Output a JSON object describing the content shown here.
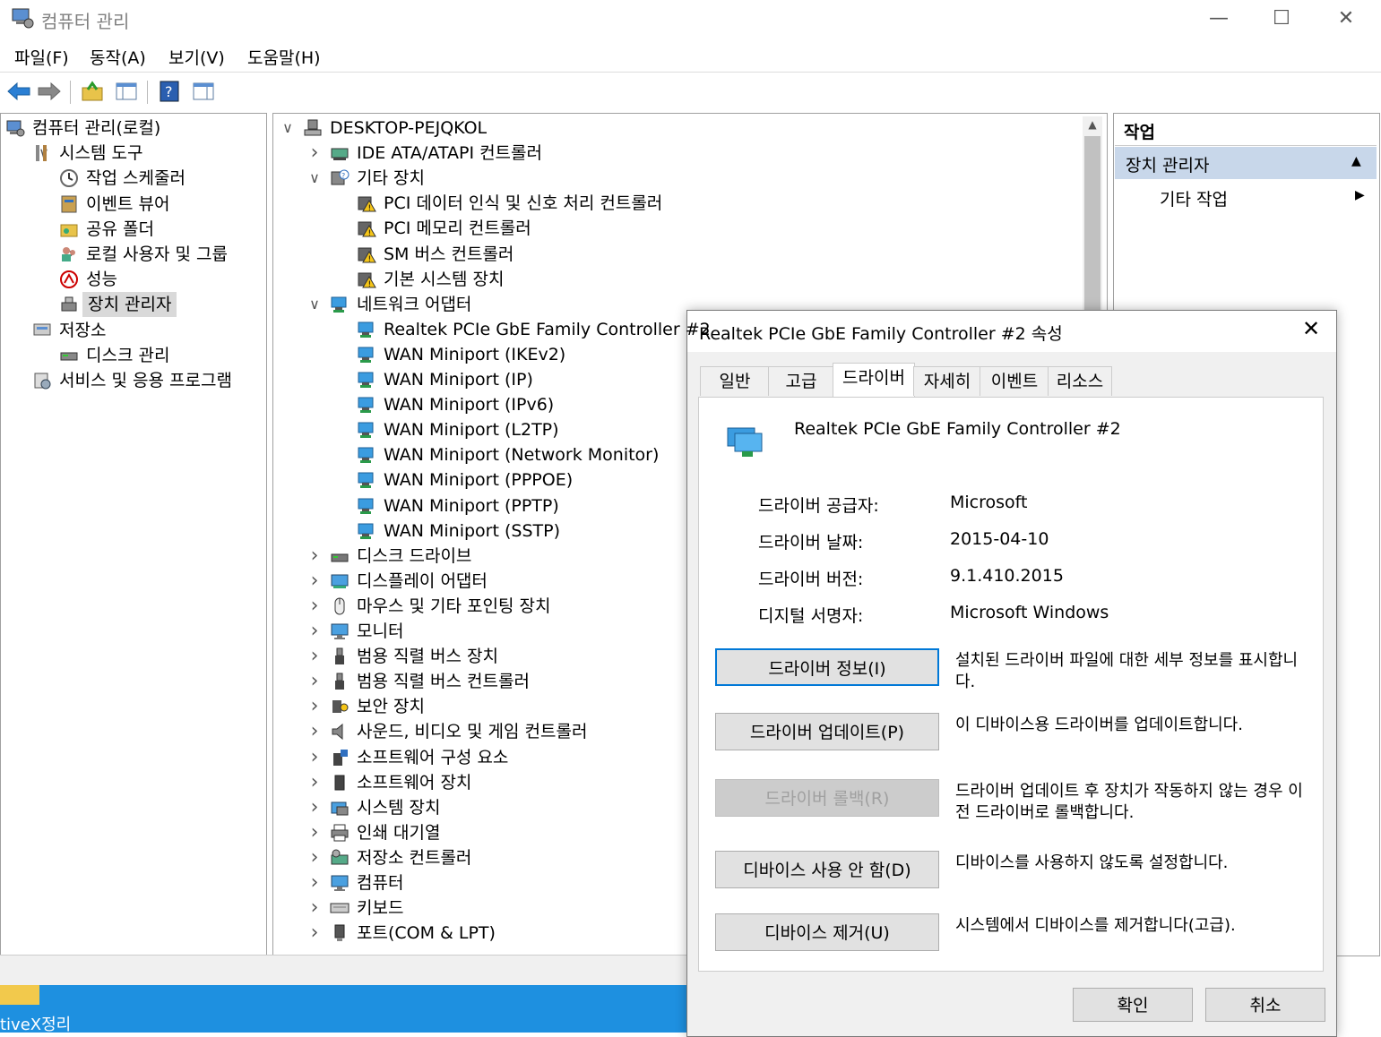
{
  "window": {
    "title": "컴퓨터 관리"
  },
  "menu": [
    "파일(F)",
    "동작(A)",
    "보기(V)",
    "도움말(H)"
  ],
  "left_tree": [
    {
      "label": "컴퓨터 관리(로컬)",
      "indent": 0,
      "chev": "",
      "icon": "computer-management-icon"
    },
    {
      "label": "시스템 도구",
      "indent": 1,
      "chev": "v",
      "icon": "tools-icon"
    },
    {
      "label": "작업 스케줄러",
      "indent": 2,
      "chev": ">",
      "icon": "clock-icon"
    },
    {
      "label": "이벤트 뷰어",
      "indent": 2,
      "chev": ">",
      "icon": "event-viewer-icon"
    },
    {
      "label": "공유 폴더",
      "indent": 2,
      "chev": ">",
      "icon": "shared-folder-icon"
    },
    {
      "label": "로컬 사용자 및 그룹",
      "indent": 2,
      "chev": ">",
      "icon": "users-icon"
    },
    {
      "label": "성능",
      "indent": 2,
      "chev": ">",
      "icon": "performance-icon"
    },
    {
      "label": "장치 관리자",
      "indent": 2,
      "chev": "",
      "icon": "device-manager-icon",
      "selected": true
    },
    {
      "label": "저장소",
      "indent": 1,
      "chev": "v",
      "icon": "storage-icon"
    },
    {
      "label": "디스크 관리",
      "indent": 2,
      "chev": "",
      "icon": "disk-management-icon"
    },
    {
      "label": "서비스 및 응용 프로그램",
      "indent": 1,
      "chev": ">",
      "icon": "services-icon"
    }
  ],
  "device_tree": [
    {
      "label": "DESKTOP-PEJQKOL",
      "indent": 0,
      "chev": "v",
      "icon": "computer-icon"
    },
    {
      "label": "IDE ATA/ATAPI 컨트롤러",
      "indent": 1,
      "chev": ">",
      "icon": "ide-controller-icon"
    },
    {
      "label": "기타 장치",
      "indent": 1,
      "chev": "v",
      "icon": "unknown-device-icon"
    },
    {
      "label": "PCI 데이터 인식 및 신호 처리 컨트롤러",
      "indent": 2,
      "chev": "",
      "icon": "warning-device-icon"
    },
    {
      "label": "PCI 메모리 컨트롤러",
      "indent": 2,
      "chev": "",
      "icon": "warning-device-icon"
    },
    {
      "label": "SM 버스 컨트롤러",
      "indent": 2,
      "chev": "",
      "icon": "warning-device-icon"
    },
    {
      "label": "기본 시스템 장치",
      "indent": 2,
      "chev": "",
      "icon": "warning-device-icon"
    },
    {
      "label": "네트워크 어댑터",
      "indent": 1,
      "chev": "v",
      "icon": "network-adapter-icon"
    },
    {
      "label": "Realtek PCIe GbE Family Controller #2",
      "indent": 2,
      "chev": "",
      "icon": "network-adapter-icon"
    },
    {
      "label": "WAN Miniport (IKEv2)",
      "indent": 2,
      "chev": "",
      "icon": "network-adapter-icon"
    },
    {
      "label": "WAN Miniport (IP)",
      "indent": 2,
      "chev": "",
      "icon": "network-adapter-icon"
    },
    {
      "label": "WAN Miniport (IPv6)",
      "indent": 2,
      "chev": "",
      "icon": "network-adapter-icon"
    },
    {
      "label": "WAN Miniport (L2TP)",
      "indent": 2,
      "chev": "",
      "icon": "network-adapter-icon"
    },
    {
      "label": "WAN Miniport (Network Monitor)",
      "indent": 2,
      "chev": "",
      "icon": "network-adapter-icon"
    },
    {
      "label": "WAN Miniport (PPPOE)",
      "indent": 2,
      "chev": "",
      "icon": "network-adapter-icon"
    },
    {
      "label": "WAN Miniport (PPTP)",
      "indent": 2,
      "chev": "",
      "icon": "network-adapter-icon"
    },
    {
      "label": "WAN Miniport (SSTP)",
      "indent": 2,
      "chev": "",
      "icon": "network-adapter-icon"
    },
    {
      "label": "디스크 드라이브",
      "indent": 1,
      "chev": ">",
      "icon": "disk-drive-icon"
    },
    {
      "label": "디스플레이 어댑터",
      "indent": 1,
      "chev": ">",
      "icon": "display-adapter-icon"
    },
    {
      "label": "마우스 및 기타 포인팅 장치",
      "indent": 1,
      "chev": ">",
      "icon": "mouse-icon"
    },
    {
      "label": "모니터",
      "indent": 1,
      "chev": ">",
      "icon": "monitor-icon"
    },
    {
      "label": "범용 직렬 버스 장치",
      "indent": 1,
      "chev": ">",
      "icon": "usb-icon"
    },
    {
      "label": "범용 직렬 버스 컨트롤러",
      "indent": 1,
      "chev": ">",
      "icon": "usb-icon"
    },
    {
      "label": "보안 장치",
      "indent": 1,
      "chev": ">",
      "icon": "security-device-icon"
    },
    {
      "label": "사운드, 비디오 및 게임 컨트롤러",
      "indent": 1,
      "chev": ">",
      "icon": "speaker-icon"
    },
    {
      "label": "소프트웨어 구성 요소",
      "indent": 1,
      "chev": ">",
      "icon": "software-component-icon"
    },
    {
      "label": "소프트웨어 장치",
      "indent": 1,
      "chev": ">",
      "icon": "software-device-icon"
    },
    {
      "label": "시스템 장치",
      "indent": 1,
      "chev": ">",
      "icon": "system-device-icon"
    },
    {
      "label": "인쇄 대기열",
      "indent": 1,
      "chev": ">",
      "icon": "printer-icon"
    },
    {
      "label": "저장소 컨트롤러",
      "indent": 1,
      "chev": ">",
      "icon": "storage-controller-icon"
    },
    {
      "label": "컴퓨터",
      "indent": 1,
      "chev": ">",
      "icon": "monitor-icon"
    },
    {
      "label": "키보드",
      "indent": 1,
      "chev": ">",
      "icon": "keyboard-icon"
    },
    {
      "label": "포트(COM & LPT)",
      "indent": 1,
      "chev": ">",
      "icon": "port-icon"
    }
  ],
  "actions": {
    "header": "작업",
    "selected": "장치 관리자",
    "more": "기타 작업"
  },
  "dialog": {
    "title": "Realtek PCIe GbE Family Controller #2 속성",
    "tabs": [
      "일반",
      "고급",
      "드라이버",
      "자세히",
      "이벤트",
      "리소스"
    ],
    "active_tab": "드라이버",
    "device_name": "Realtek PCIe GbE Family Controller #2",
    "fields": [
      {
        "label": "드라이버 공급자:",
        "value": "Microsoft"
      },
      {
        "label": "드라이버 날짜:",
        "value": "2015-04-10"
      },
      {
        "label": "드라이버 버전:",
        "value": "9.1.410.2015"
      },
      {
        "label": "디지털 서명자:",
        "value": "Microsoft Windows"
      }
    ],
    "buttons": [
      {
        "label": "드라이버 정보(I)",
        "desc": "설치된 드라이버 파일에 대한 세부 정보를 표시합니다.",
        "state": "focus"
      },
      {
        "label": "드라이버 업데이트(P)",
        "desc": "이 디바이스용 드라이버를 업데이트합니다.",
        "state": "normal"
      },
      {
        "label": "드라이버 롤백(R)",
        "desc": "드라이버 업데이트 후 장치가 작동하지 않는 경우 이전 드라이버로 롤백합니다.",
        "state": "disabled"
      },
      {
        "label": "디바이스 사용 안 함(D)",
        "desc": "디바이스를 사용하지 않도록 설정합니다.",
        "state": "normal"
      },
      {
        "label": "디바이스 제거(U)",
        "desc": "시스템에서 디바이스를 제거합니다(고급).",
        "state": "normal"
      }
    ],
    "ok": "확인",
    "cancel": "취소"
  },
  "taskbar": {
    "label": "tiveX정리"
  },
  "colors": {
    "accent": "#0078d7",
    "selection": "#c8d7ea",
    "taskbar": "#1e90e0"
  }
}
